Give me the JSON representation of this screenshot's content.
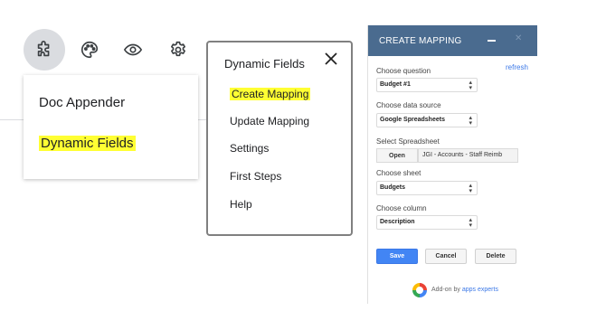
{
  "toolbar": {
    "icons": [
      "puzzle-icon",
      "palette-icon",
      "eye-icon",
      "gear-icon"
    ]
  },
  "addon_menu": {
    "items": [
      "Doc Appender",
      "Dynamic Fields"
    ]
  },
  "dynamic_fields_menu": {
    "title": "Dynamic Fields",
    "items": [
      "Create Mapping",
      "Update Mapping",
      "Settings",
      "First Steps",
      "Help"
    ]
  },
  "create_mapping": {
    "title": "CREATE MAPPING",
    "refresh_label": "refresh",
    "question_label": "Choose question",
    "question_value": "Budget #1",
    "source_label": "Choose data source",
    "source_value": "Google Spreadsheets",
    "spreadsheet_label": "Select Spreadsheet",
    "open_label": "Open",
    "spreadsheet_name": "JGI - Accounts - Staff Reimb",
    "sheet_label": "Choose sheet",
    "sheet_value": "Budgets",
    "column_label": "Choose column",
    "column_value": "Description",
    "save_label": "Save",
    "cancel_label": "Cancel",
    "delete_label": "Delete",
    "footer_prefix": "Add-on by",
    "footer_brand": "apps experts"
  },
  "colors": {
    "highlight": "#ffff33",
    "dialog_header": "#4a6b8f",
    "primary_button": "#4285f4",
    "link": "#3b78e7"
  }
}
